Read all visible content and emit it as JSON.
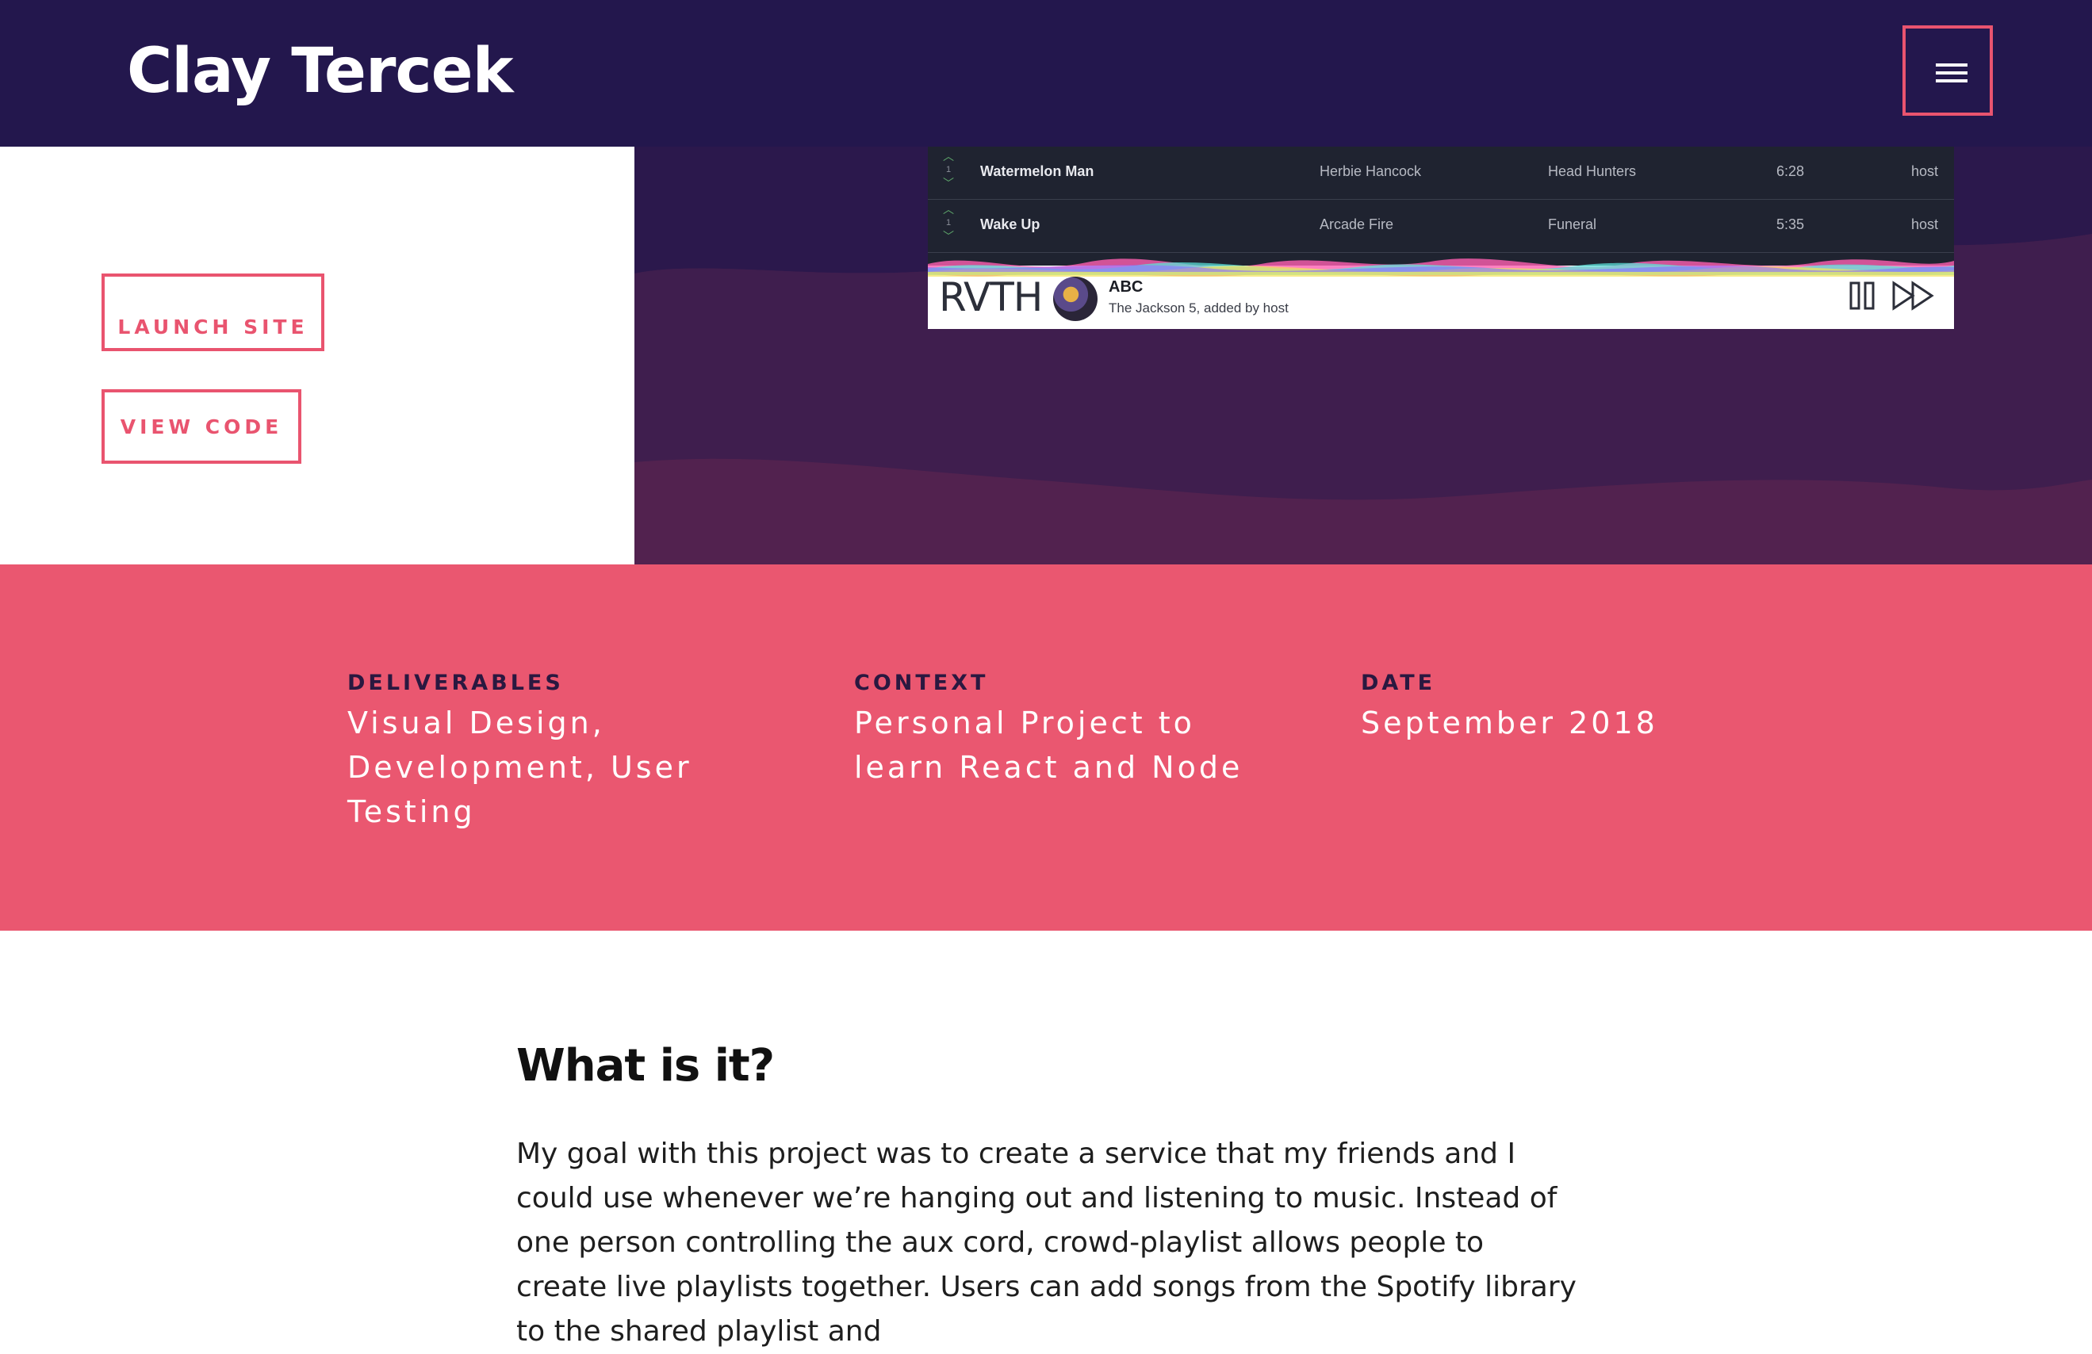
{
  "header": {
    "brand": "Clay Tercek",
    "menu_icon": "hamburger-menu-icon"
  },
  "hero": {
    "launch_label": "LAUNCH SITE",
    "code_label": "VIEW CODE",
    "colors": {
      "accent": "#e9546f",
      "header_bg": "#23174d",
      "hero_bg": "#421e4e"
    },
    "mockup": {
      "tracks": [
        {
          "votes": "1",
          "title": "Watermelon Man",
          "artist": "Herbie Hancock",
          "album": "Head Hunters",
          "duration": "6:28",
          "added_by": "host"
        },
        {
          "votes": "1",
          "title": "Wake Up",
          "artist": "Arcade Fire",
          "album": "Funeral",
          "duration": "5:35",
          "added_by": "host"
        }
      ],
      "player": {
        "logo": "RVTH",
        "now_playing_title": "ABC",
        "now_playing_sub": "The Jackson 5, added by host",
        "pause_icon": "pause-icon",
        "skip_icon": "skip-forward-icon"
      }
    }
  },
  "info": {
    "bg": "#ea5770",
    "deliverables_label": "DELIVERABLES",
    "deliverables_value": "Visual Design, Development, User Testing",
    "context_label": "CONTEXT",
    "context_value": "Personal Project to learn React and Node",
    "date_label": "DATE",
    "date_value": "September 2018"
  },
  "content": {
    "heading": "What is it?",
    "paragraph": "My goal with this project was to create a service that my friends and I could use whenever we’re hanging out and listening to music. Instead of one person controlling the aux cord, crowd-playlist allows people to create live playlists together. Users can add songs from the Spotify library to the shared playlist and"
  }
}
